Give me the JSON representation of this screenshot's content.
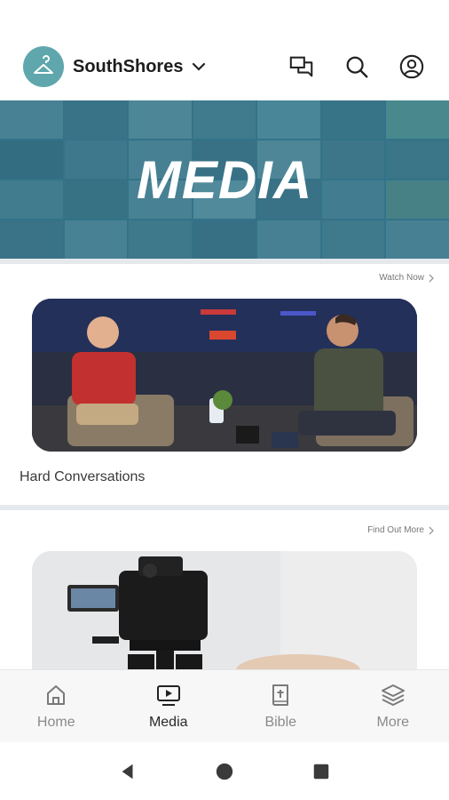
{
  "app": {
    "org_name": "SouthShores",
    "accent_color": "#5fa7ad"
  },
  "header": {
    "icons": [
      "chat-icon",
      "search-icon",
      "account-icon"
    ]
  },
  "hero": {
    "title": "MEDIA"
  },
  "sections": [
    {
      "link_label": "Watch Now",
      "card_title": "Hard Conversations",
      "image": "two-men-seated-conversation-stage"
    },
    {
      "link_label": "Find Out More",
      "image": "camera-on-tripod"
    }
  ],
  "bottom_nav": {
    "items": [
      {
        "label": "Home",
        "icon": "home-icon",
        "active": false
      },
      {
        "label": "Media",
        "icon": "media-icon",
        "active": true
      },
      {
        "label": "Bible",
        "icon": "bible-icon",
        "active": false
      },
      {
        "label": "More",
        "icon": "layers-icon",
        "active": false
      }
    ]
  },
  "system_nav": [
    "back-icon",
    "home-circle-icon",
    "recents-icon"
  ]
}
